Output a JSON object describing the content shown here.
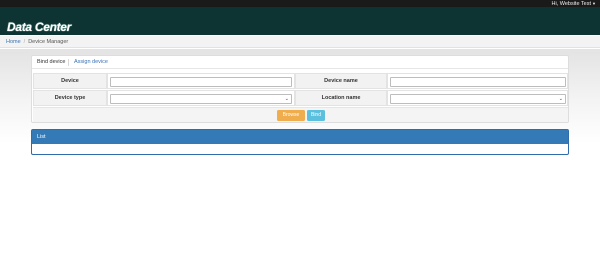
{
  "topbar": {
    "user_greeting": "Hi,  Website Test",
    "caret_icon": "caret-down-icon"
  },
  "brand": {
    "title": "Data Center"
  },
  "breadcrumb": {
    "home": "Home",
    "separator": "/",
    "current": "Device Manager"
  },
  "tabs": {
    "bind_device": "Bind device",
    "assign_device": "Assign device"
  },
  "form": {
    "device_label": "Device",
    "device_value": "",
    "device_name_label": "Device name",
    "device_name_value": "",
    "device_type_label": "Device type",
    "device_type_selected": "",
    "location_name_label": "Location name",
    "location_name_selected": ""
  },
  "buttons": {
    "browse": "Browse",
    "bind": "Bind"
  },
  "colors": {
    "topbar": "#1a1a1a",
    "brandbar": "#0d3432",
    "browse": "#f0ad4e",
    "bind": "#5bc0de",
    "list_header": "#337ab7"
  },
  "list": {
    "title": "List"
  }
}
